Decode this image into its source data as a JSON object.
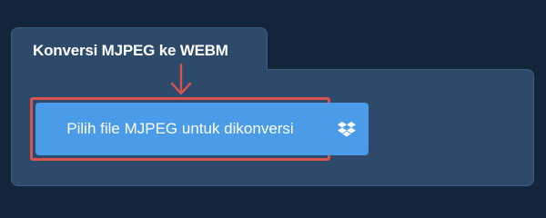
{
  "converter": {
    "title": "Konversi MJPEG ke WEBM",
    "choose_file_label": "Pilih file MJPEG untuk dikonversi",
    "dropbox_icon": "dropbox-icon"
  },
  "colors": {
    "background": "#13253a",
    "panel": "#2d4a6a",
    "button": "#4a9ce8",
    "highlight": "#d9534f"
  }
}
